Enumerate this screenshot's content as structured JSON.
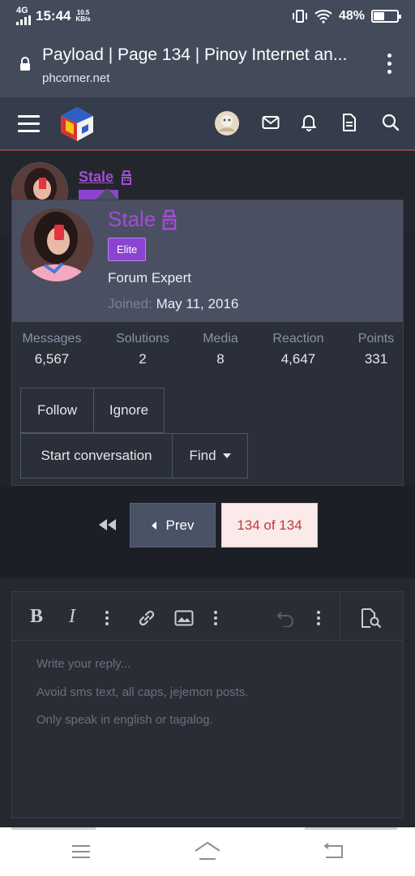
{
  "status_bar": {
    "network": "4G",
    "time": "15:44",
    "speed_value": "10.5",
    "speed_unit": "KB/s",
    "battery": "48%",
    "battery_level": 0.48
  },
  "browser": {
    "page_title": "Payload | Page 134 | Pinoy Internet an...",
    "domain": "phcorner.net"
  },
  "header": {
    "icons": [
      "menu-icon",
      "logo",
      "avatar",
      "mail-icon",
      "bell-icon",
      "document-icon",
      "search-icon"
    ]
  },
  "member_card": {
    "username": "Stale",
    "badge": "Elite",
    "role": "Forum Expert",
    "joined_label": "Joined:",
    "joined_date": "May 11, 2016",
    "stats": [
      {
        "label": "Messages",
        "value": "6,567"
      },
      {
        "label": "Solutions",
        "value": "2"
      },
      {
        "label": "Media",
        "value": "8"
      },
      {
        "label": "Reaction",
        "value": "4,647"
      },
      {
        "label": "Points",
        "value": "331"
      }
    ],
    "buttons": {
      "follow": "Follow",
      "ignore": "Ignore",
      "start_conversation": "Start conversation",
      "find": "Find"
    }
  },
  "pagination": {
    "prev": "Prev",
    "current": "134 of 134"
  },
  "editor": {
    "placeholder_lines": [
      "Write your reply...",
      "Avoid sms text, all caps, jejemon posts.",
      "Only speak in english or tagalog."
    ]
  },
  "colors": {
    "accent_purple": "#a24cd6",
    "elite_badge": "#8b44cf",
    "current_page_bg": "#fbeaea",
    "current_page_text": "#c23a3a"
  }
}
